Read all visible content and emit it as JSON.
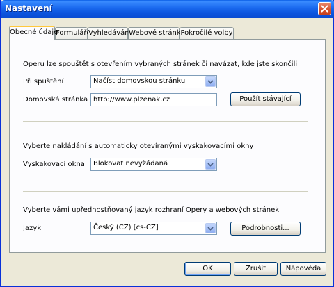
{
  "window": {
    "title": "Nastavení"
  },
  "tabs": [
    {
      "label": "Obecné údaje",
      "active": true
    },
    {
      "label": "Formuláře"
    },
    {
      "label": "Vyhledávání"
    },
    {
      "label": "Webové stránky"
    },
    {
      "label": "Pokročilé volby"
    }
  ],
  "startup": {
    "description": "Operu lze spouštět s otevřením vybraných stránek či navázat, kde jste skončili",
    "on_start_label": "Při spuštění",
    "on_start_value": "Načíst domovskou stránku",
    "homepage_label": "Domovská stránka",
    "homepage_value": "http://www.plzenak.cz",
    "use_current_button": "Použít stávající"
  },
  "popups": {
    "description": "Vyberte nakládání s automaticky otevíranými vyskakovacími okny",
    "label": "Vyskakovací okna",
    "value": "Blokovat nevyžádaná"
  },
  "language": {
    "description": "Vyberte vámi upřednostňovaný jazyk rozhraní Opery a webových stránek",
    "label": "Jazyk",
    "value": "Český (CZ) [cs-CZ]",
    "details_button": "Podrobnosti..."
  },
  "footer": {
    "ok": "OK",
    "cancel": "Zrušit",
    "help": "Nápověda"
  },
  "icons": {
    "close": "close-icon",
    "dropdown": "chevron-down-icon"
  }
}
